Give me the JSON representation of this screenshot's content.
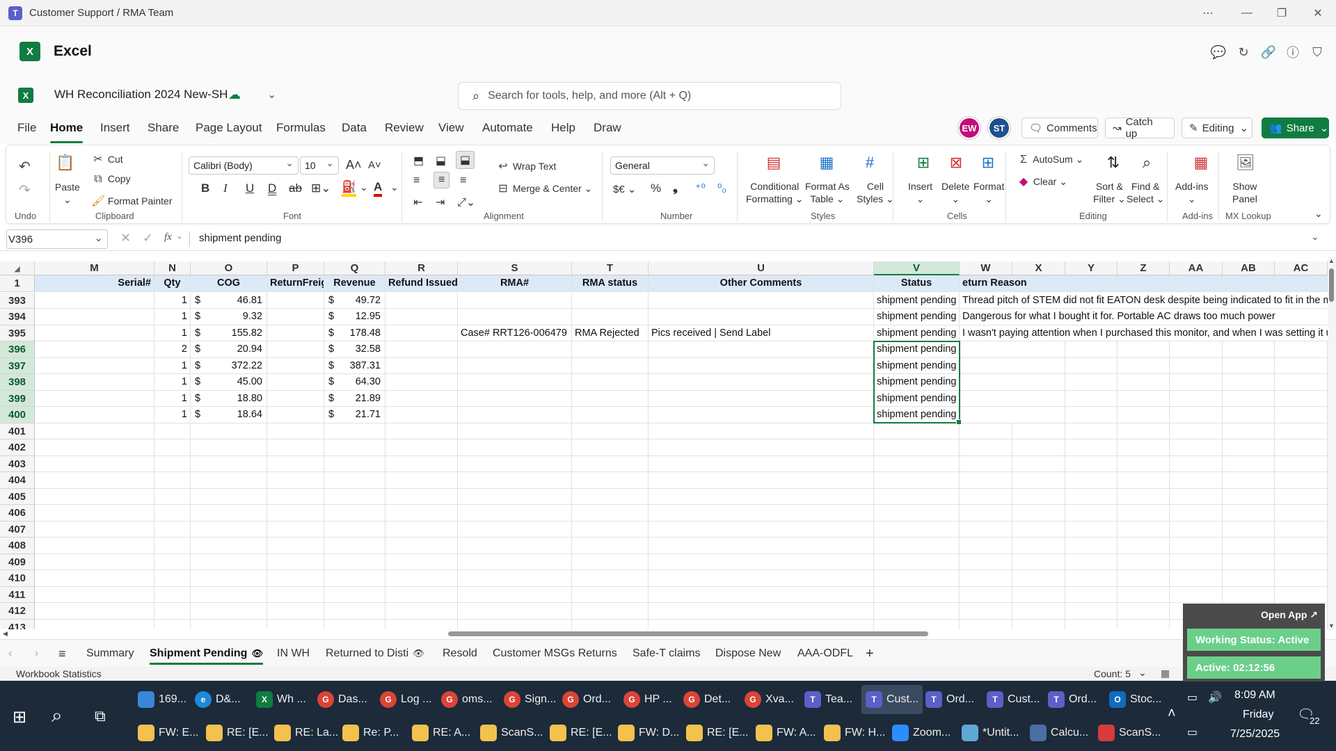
{
  "window": {
    "title": "Customer Support / RMA Team"
  },
  "app": {
    "name": "Excel"
  },
  "file": {
    "name": "WH Reconciliation 2024 New-SH"
  },
  "search": {
    "placeholder": "Search for tools, help, and more (Alt + Q)"
  },
  "menu": [
    "File",
    "Home",
    "Insert",
    "Share",
    "Page Layout",
    "Formulas",
    "Data",
    "Review",
    "View",
    "Automate",
    "Help",
    "Draw"
  ],
  "avatars": [
    {
      "initials": "EW",
      "color": "#c30e7a"
    },
    {
      "initials": "ST",
      "color": "#1f4f8f"
    }
  ],
  "header_buttons": {
    "comments": "Comments",
    "catchup": "Catch up",
    "editing": "Editing",
    "share": "Share"
  },
  "ribbon": {
    "undo_group": "Undo",
    "clipboard": {
      "paste": "Paste",
      "cut": "Cut",
      "copy": "Copy",
      "format_painter": "Format Painter",
      "label": "Clipboard"
    },
    "font": {
      "name": "Calibri (Body)",
      "size": "10",
      "label": "Font"
    },
    "alignment": {
      "wrap": "Wrap Text",
      "merge": "Merge & Center",
      "label": "Alignment"
    },
    "number": {
      "format": "General",
      "currency": "$€",
      "percent": "%",
      "comma": "❟",
      "label": "Number"
    },
    "styles": {
      "cond1": "Conditional",
      "cond2": "Formatting",
      "fmt1": "Format As",
      "fmt2": "Table",
      "cell1": "Cell",
      "cell2": "Styles",
      "label": "Styles"
    },
    "cells": {
      "insert": "Insert",
      "delete": "Delete",
      "format": "Format",
      "label": "Cells"
    },
    "editing": {
      "autosum": "AutoSum",
      "clear": "Clear",
      "sort1": "Sort &",
      "sort2": "Filter",
      "find1": "Find &",
      "find2": "Select",
      "label": "Editing"
    },
    "addins": {
      "btn": "Add-ins",
      "label": "Add-ins"
    },
    "mx": {
      "btn1": "Show",
      "btn2": "Panel",
      "label": "MX Lookup"
    }
  },
  "formula_bar": {
    "cell_ref": "V396",
    "fx": "fx",
    "value": "shipment pending"
  },
  "columns": [
    "M",
    "N",
    "O",
    "P",
    "Q",
    "R",
    "S",
    "T",
    "U",
    "V",
    "W",
    "X",
    "Y",
    "Z",
    "AA",
    "AB",
    "AC"
  ],
  "header_row": {
    "num": "1",
    "M": "Serial#",
    "N": "Qty",
    "O": "COG",
    "P": "ReturnFreigh",
    "Q": "Revenue",
    "R": "Refund Issued",
    "S": "RMA#",
    "T": "RMA status",
    "U": "Other Comments",
    "V": "Status",
    "W": "eturn Reason"
  },
  "rows": [
    {
      "num": "393",
      "qty": "1",
      "cog": "46.81",
      "rev": "49.72",
      "rma": "",
      "rmastatus": "",
      "comments": "",
      "status": "shipment pending",
      "reason": "Thread pitch of STEM did not fit EATON desk despite being indicated to fit in the m"
    },
    {
      "num": "394",
      "qty": "1",
      "cog": "9.32",
      "rev": "12.95",
      "rma": "",
      "rmastatus": "",
      "comments": "",
      "status": "shipment pending",
      "reason": "Dangerous for what I bought it for. Portable AC draws too much power"
    },
    {
      "num": "395",
      "qty": "1",
      "cog": "155.82",
      "rev": "178.48",
      "rma": "Case# RRT126-006479",
      "rmastatus": "RMA Rejected",
      "comments": "Pics received | Send Label",
      "status": "shipment pending",
      "reason": "I wasn't paying attention when I purchased this monitor, and when I was setting it u"
    },
    {
      "num": "396",
      "qty": "2",
      "cog": "20.94",
      "rev": "32.58",
      "rma": "",
      "rmastatus": "",
      "comments": "",
      "status": "shipment pending",
      "reason": ""
    },
    {
      "num": "397",
      "qty": "1",
      "cog": "372.22",
      "rev": "387.31",
      "rma": "",
      "rmastatus": "",
      "comments": "",
      "status": "shipment pending",
      "reason": ""
    },
    {
      "num": "398",
      "qty": "1",
      "cog": "45.00",
      "rev": "64.30",
      "rma": "",
      "rmastatus": "",
      "comments": "",
      "status": "shipment pending",
      "reason": ""
    },
    {
      "num": "399",
      "qty": "1",
      "cog": "18.80",
      "rev": "21.89",
      "rma": "",
      "rmastatus": "",
      "comments": "",
      "status": "shipment pending",
      "reason": ""
    },
    {
      "num": "400",
      "qty": "1",
      "cog": "18.64",
      "rev": "21.71",
      "rma": "",
      "rmastatus": "",
      "comments": "",
      "status": "shipment pending",
      "reason": ""
    }
  ],
  "empty_rows": [
    "401",
    "402",
    "403",
    "404",
    "405",
    "406",
    "407",
    "408",
    "409",
    "410",
    "411",
    "412",
    "413"
  ],
  "currency_symbol": "$",
  "sheet_tabs": [
    "Summary",
    "Shipment Pending",
    "IN WH",
    "Returned to Disti",
    "Resold",
    "Customer MSGs Returns",
    "Safe-T claims",
    "Dispose New",
    "AAA-ODFL"
  ],
  "active_tab": "Shipment Pending",
  "statusbar": {
    "left": "Workbook Statistics",
    "count": "Count: 5"
  },
  "widget": {
    "open_app": "Open App ↗",
    "working": "Working Status: Active",
    "active": "Active: 02:12:56"
  },
  "taskbar_row1": [
    {
      "label": "169...",
      "color": "#3a86d8",
      "glyph": ""
    },
    {
      "label": "D&...",
      "color": "#1b8adb",
      "glyph": "e"
    },
    {
      "label": "Wh ...",
      "color": "#107c41",
      "glyph": "X"
    },
    {
      "label": "Das...",
      "color": "#db4437",
      "glyph": "G"
    },
    {
      "label": "Log ...",
      "color": "#db4437",
      "glyph": "G"
    },
    {
      "label": "oms...",
      "color": "#db4437",
      "glyph": "G"
    },
    {
      "label": "Sign...",
      "color": "#db4437",
      "glyph": "G"
    },
    {
      "label": "Ord...",
      "color": "#db4437",
      "glyph": "G"
    },
    {
      "label": "HP ...",
      "color": "#db4437",
      "glyph": "G"
    },
    {
      "label": "Det...",
      "color": "#db4437",
      "glyph": "G"
    },
    {
      "label": "Xva...",
      "color": "#db4437",
      "glyph": "G"
    },
    {
      "label": "Tea...",
      "color": "#5b5fc7",
      "glyph": "T"
    },
    {
      "label": "Cust...",
      "color": "#5b5fc7",
      "glyph": "T"
    },
    {
      "label": "Ord...",
      "color": "#5b5fc7",
      "glyph": "T"
    },
    {
      "label": "Cust...",
      "color": "#5b5fc7",
      "glyph": "T"
    },
    {
      "label": "Ord...",
      "color": "#5b5fc7",
      "glyph": "T"
    },
    {
      "label": "Stoc...",
      "color": "#0f6cbd",
      "glyph": "O"
    }
  ],
  "taskbar_row2": [
    {
      "label": "FW: E...",
      "color": "#f2c14e"
    },
    {
      "label": "RE: [E...",
      "color": "#f2c14e"
    },
    {
      "label": "RE: La...",
      "color": "#f2c14e"
    },
    {
      "label": "Re: P...",
      "color": "#f2c14e"
    },
    {
      "label": "RE: A...",
      "color": "#f2c14e"
    },
    {
      "label": "ScanS...",
      "color": "#f2c14e"
    },
    {
      "label": "RE: [E...",
      "color": "#f2c14e"
    },
    {
      "label": "FW: D...",
      "color": "#f2c14e"
    },
    {
      "label": "RE: [E...",
      "color": "#f2c14e"
    },
    {
      "label": "FW: A...",
      "color": "#f2c14e"
    },
    {
      "label": "FW: H...",
      "color": "#f2c14e"
    },
    {
      "label": "Zoom...",
      "color": "#2d8cff"
    },
    {
      "label": "*Untit...",
      "color": "#5fa8d3"
    },
    {
      "label": "Calcu...",
      "color": "#4a6fa5"
    },
    {
      "label": "ScanS...",
      "color": "#d83b3b"
    }
  ],
  "clock": {
    "time": "8:09 AM",
    "day": "Friday",
    "date": "7/25/2025"
  },
  "notifications": "22",
  "zoom": {
    "badge": "zoom"
  },
  "badge_count": "7"
}
